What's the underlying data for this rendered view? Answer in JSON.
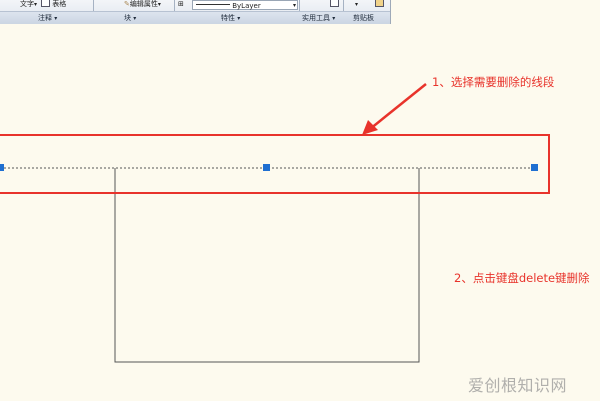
{
  "ribbon": {
    "text_label": "文字",
    "table_label": "表格",
    "edit_attributes_label": "编辑属性",
    "bylayer_value": "ByLayer",
    "panels": [
      {
        "label": "注释"
      },
      {
        "label": "块"
      },
      {
        "label": "特性"
      },
      {
        "label": "实用工具"
      },
      {
        "label": "剪贴板"
      }
    ]
  },
  "annotations": {
    "step1": "1、选择需要删除的线段",
    "step2": "2、点击键盘delete键删除"
  },
  "watermark": "爱创根知识网",
  "colors": {
    "canvas_background": "#fdfaee",
    "annotation_red": "#e8332b",
    "grip_blue": "#1f6fd1",
    "line_gray": "#555555"
  }
}
